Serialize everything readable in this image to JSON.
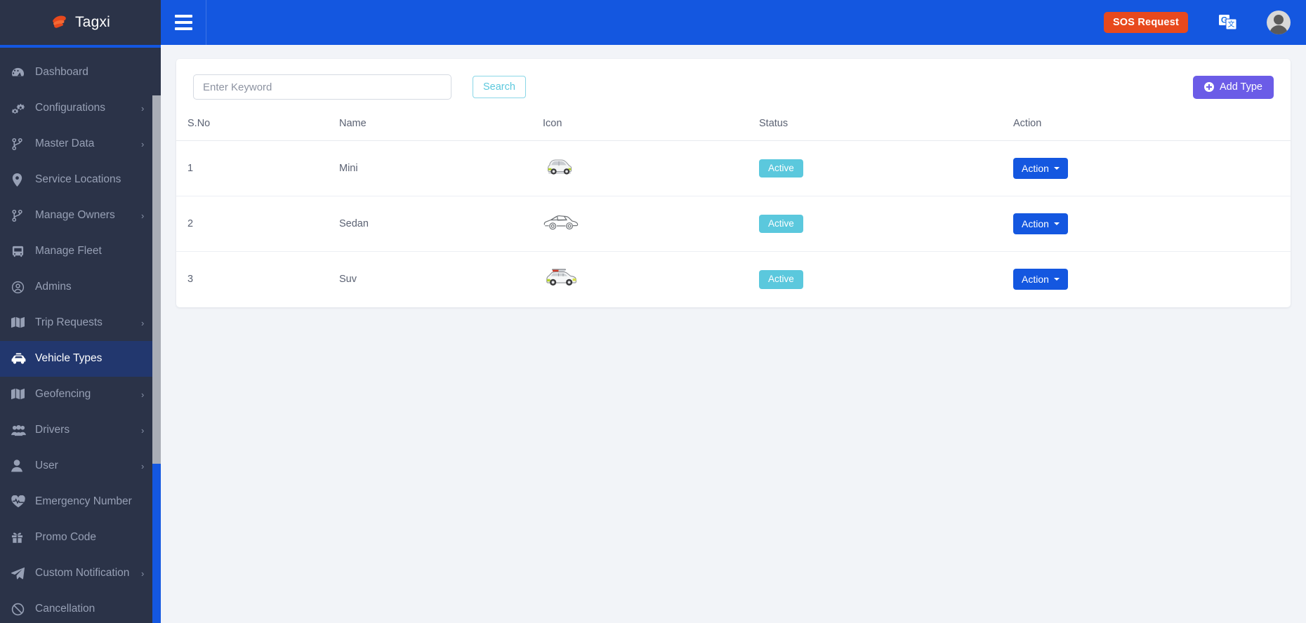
{
  "brand": {
    "name": "Tagxi",
    "logo_icon": "tagxi-hand-logo",
    "accent": "#e8491d"
  },
  "theme": {
    "sidebar_bg": "#2b3348",
    "sidebar_active_bg": "#22376e",
    "topbar_bg": "#1457e0",
    "page_bg": "#f2f4f8",
    "badge_active": "#5bc8dd",
    "add_button": "#6b5ce7",
    "sos_button": "#e8491d",
    "search_button_border": "#8ad7e7"
  },
  "sidebar": {
    "items": [
      {
        "label": "Dashboard",
        "icon": "dashboard-icon",
        "has_submenu": false,
        "active": false
      },
      {
        "label": "Configurations",
        "icon": "gears-icon",
        "has_submenu": true,
        "active": false
      },
      {
        "label": "Master Data",
        "icon": "sitemap-icon",
        "has_submenu": true,
        "active": false
      },
      {
        "label": "Service Locations",
        "icon": "map-pin-icon",
        "has_submenu": false,
        "active": false
      },
      {
        "label": "Manage Owners",
        "icon": "sitemap-icon",
        "has_submenu": true,
        "active": false
      },
      {
        "label": "Manage Fleet",
        "icon": "bus-icon",
        "has_submenu": false,
        "active": false
      },
      {
        "label": "Admins",
        "icon": "user-circle-icon",
        "has_submenu": false,
        "active": false
      },
      {
        "label": "Trip Requests",
        "icon": "map-icon",
        "has_submenu": true,
        "active": false
      },
      {
        "label": "Vehicle Types",
        "icon": "taxi-icon",
        "has_submenu": false,
        "active": true
      },
      {
        "label": "Geofencing",
        "icon": "map-icon",
        "has_submenu": true,
        "active": false
      },
      {
        "label": "Drivers",
        "icon": "users-icon",
        "has_submenu": true,
        "active": false
      },
      {
        "label": "User",
        "icon": "user-icon",
        "has_submenu": true,
        "active": false
      },
      {
        "label": "Emergency Number",
        "icon": "heartbeat-icon",
        "has_submenu": false,
        "active": false
      },
      {
        "label": "Promo Code",
        "icon": "gift-icon",
        "has_submenu": false,
        "active": false
      },
      {
        "label": "Custom Notification",
        "icon": "paper-plane-icon",
        "has_submenu": true,
        "active": false
      },
      {
        "label": "Cancellation",
        "icon": "ban-icon",
        "has_submenu": false,
        "active": false
      }
    ]
  },
  "topbar": {
    "menu_toggle_icon": "hamburger-icon",
    "sos_label": "SOS Request",
    "translate_icon": "google-translate-icon",
    "avatar_icon": "user-avatar-icon"
  },
  "toolbar": {
    "search_placeholder": "Enter Keyword",
    "search_value": "",
    "search_label": "Search",
    "add_label": "Add Type",
    "add_icon": "plus-circle-icon"
  },
  "table": {
    "columns": [
      "S.No",
      "Name",
      "Icon",
      "Status",
      "Action"
    ],
    "rows": [
      {
        "sno": "1",
        "name": "Mini",
        "icon": "hatchback-car-icon",
        "status": "Active",
        "action": "Action"
      },
      {
        "sno": "2",
        "name": "Sedan",
        "icon": "sedan-car-icon",
        "status": "Active",
        "action": "Action"
      },
      {
        "sno": "3",
        "name": "Suv",
        "icon": "suv-car-icon",
        "status": "Active",
        "action": "Action"
      }
    ]
  }
}
